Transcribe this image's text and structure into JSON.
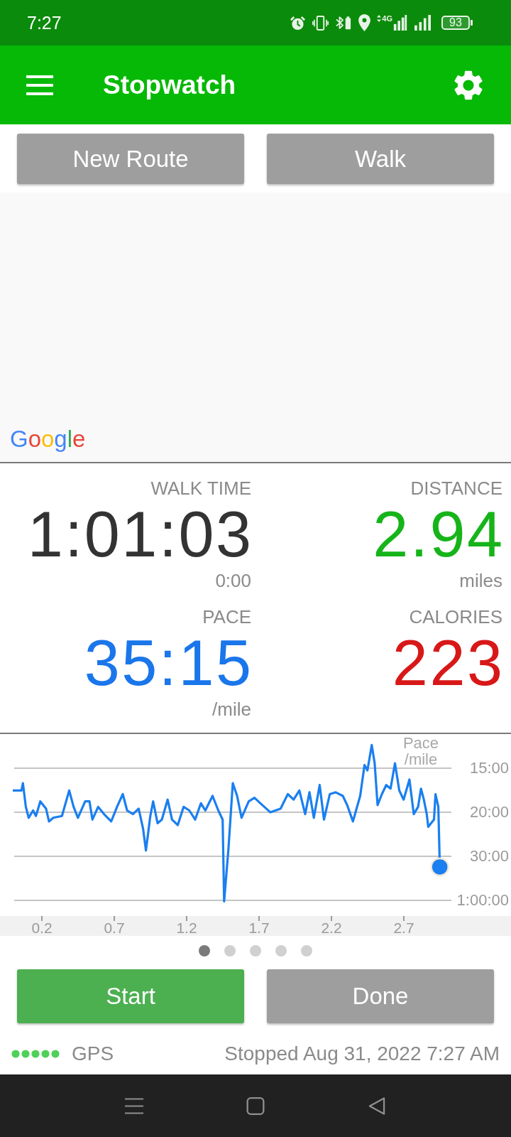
{
  "status_bar": {
    "time": "7:27",
    "network": "4G",
    "battery": "93"
  },
  "app_bar": {
    "title": "Stopwatch"
  },
  "top_buttons": [
    {
      "label": "New Route"
    },
    {
      "label": "Walk"
    }
  ],
  "map": {
    "logo": "Google"
  },
  "stats": [
    {
      "label": "WALK TIME",
      "value": "1:01:03",
      "sub": "0:00",
      "color": "#333333"
    },
    {
      "label": "DISTANCE",
      "value": "2.94",
      "sub": "miles",
      "color": "#16b41a"
    },
    {
      "label": "PACE",
      "value": "35:15",
      "sub": "/mile",
      "color": "#1a76ea"
    },
    {
      "label": "CALORIES",
      "value": "223",
      "color": "#d81818"
    }
  ],
  "chart": {
    "axis_title": "Pace /mile",
    "y_labels": [
      "15:00",
      "20:00",
      "30:00",
      "1:00:00"
    ],
    "x_labels": [
      "0.2",
      "0.7",
      "1.2",
      "1.7",
      "2.2",
      "2.7"
    ]
  },
  "pager": [
    {
      "selected": true
    },
    {
      "selected": false
    },
    {
      "selected": false
    },
    {
      "selected": false
    },
    {
      "selected": false
    }
  ],
  "actions": [
    {
      "label": "Start",
      "kind": "primary"
    },
    {
      "label": "Done",
      "kind": "secondary"
    }
  ],
  "footer": {
    "gps": "GPS",
    "status": "Stopped Aug 31, 2022 7:27 AM"
  }
}
